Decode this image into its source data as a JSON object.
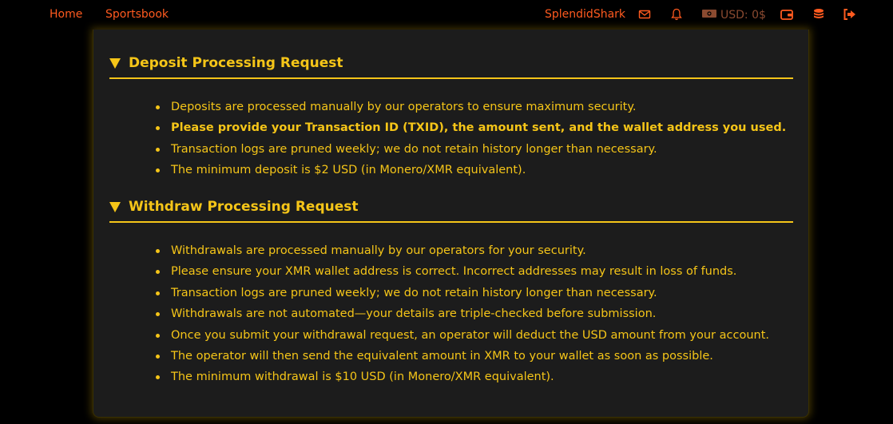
{
  "nav": {
    "home": "Home",
    "sportsbook": "Sportsbook",
    "username": "SplendidShark",
    "balance": "USD: 0$",
    "icons": [
      "mail-icon",
      "bell-icon",
      "money-icon",
      "wallet-icon",
      "coins-icon",
      "logout-icon"
    ]
  },
  "deposit": {
    "title": "Deposit Processing Request",
    "items": [
      "Deposits are processed manually by our operators to ensure maximum security.",
      "Please provide your Transaction ID (TXID), the amount sent, and the wallet address you used.",
      "Transaction logs are pruned weekly; we do not retain history longer than necessary.",
      "The minimum deposit is $2 USD (in Monero/XMR equivalent)."
    ]
  },
  "withdraw": {
    "title": "Withdraw Processing Request",
    "items": [
      "Withdrawals are processed manually by our operators for your security.",
      "Please ensure your XMR wallet address is correct. Incorrect addresses may result in loss of funds.",
      "Transaction logs are pruned weekly; we do not retain history longer than necessary.",
      "Withdrawals are not automated—your details are triple-checked before submission.",
      "Once you submit your withdrawal request, an operator will deduct the USD amount from your account.",
      "The operator will then send the equivalent amount in XMR to your wallet as soon as possible.",
      "The minimum withdrawal is $10 USD (in Monero/XMR equivalent)."
    ]
  },
  "colors": {
    "accent": "#f5c518",
    "nav_link": "#ff5a1f",
    "panel_bg": "#1c1c1c",
    "page_bg": "#000000"
  }
}
